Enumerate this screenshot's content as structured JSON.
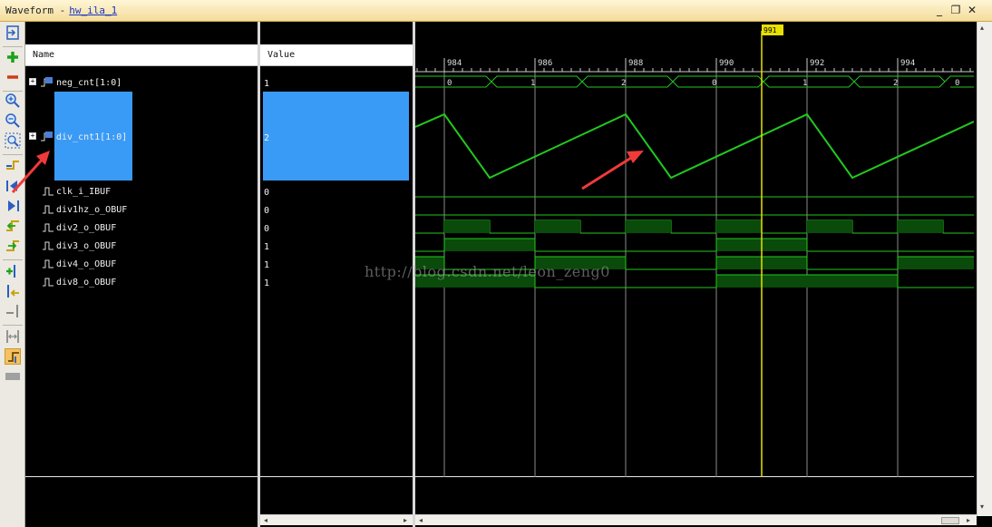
{
  "window": {
    "title": "Waveform -",
    "link": "hw_ila_1",
    "minimize": "_",
    "restore": "❐",
    "close": "✕"
  },
  "columns": {
    "name": "Name",
    "value": "Value"
  },
  "signals": [
    {
      "name": "neg_cnt[1:0]",
      "value": "1",
      "bus": true
    },
    {
      "name": "div_cnt1[1:0]",
      "value": "2",
      "bus": true,
      "selected": true
    },
    {
      "name": "clk_i_IBUF",
      "value": "0"
    },
    {
      "name": "div1hz_o_OBUF",
      "value": "0"
    },
    {
      "name": "div2_o_OBUF",
      "value": "0"
    },
    {
      "name": "div3_o_OBUF",
      "value": "1"
    },
    {
      "name": "div4_o_OBUF",
      "value": "1"
    },
    {
      "name": "div8_o_OBUF",
      "value": "1"
    }
  ],
  "timeline": {
    "ticks": [
      "984",
      "986",
      "988",
      "990",
      "992",
      "994"
    ],
    "cursor": "991",
    "neg_cnt_segments": [
      "0",
      "1",
      "2",
      "0",
      "1",
      "2",
      "0"
    ]
  },
  "watermark": "http://blog.csdn.net/leon_zeng0",
  "colors": {
    "wave": "#22c91e",
    "selection": "#3a9bf7",
    "cursor": "#e8e000",
    "arrow": "#f03a3a"
  }
}
